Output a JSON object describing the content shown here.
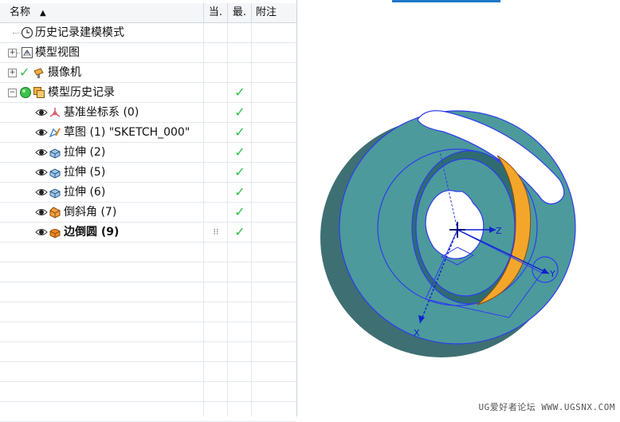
{
  "columns": {
    "name": "名称",
    "current": "当.",
    "uptodate": "最.",
    "notes": "附注"
  },
  "rows": [
    {
      "label": "历史记录建模模式",
      "icon": "clock-icon",
      "level": 0,
      "expander": "",
      "check": "",
      "current": ""
    },
    {
      "label": "模型视图",
      "icon": "model-view-icon",
      "level": 0,
      "expander": "+",
      "check": "",
      "current": ""
    },
    {
      "label": "摄像机",
      "icon": "camera-icon",
      "level": 0,
      "expander": "+",
      "check": "✓",
      "current": ""
    },
    {
      "label": "模型历史记录",
      "icon": "history-icon",
      "level": 0,
      "expander": "−",
      "check": "✓",
      "current": ""
    },
    {
      "label": "基准坐标系 (0)",
      "icon": "datum-csys-icon",
      "level": 1,
      "expander": "",
      "check": "✓",
      "current": ""
    },
    {
      "label": "草图 (1) \"SKETCH_000\"",
      "icon": "sketch-icon",
      "level": 1,
      "expander": "",
      "check": "✓",
      "current": ""
    },
    {
      "label": "拉伸 (2)",
      "icon": "extrude-icon",
      "level": 1,
      "expander": "",
      "check": "✓",
      "current": ""
    },
    {
      "label": "拉伸 (5)",
      "icon": "extrude-icon",
      "level": 1,
      "expander": "",
      "check": "✓",
      "current": ""
    },
    {
      "label": "拉伸 (6)",
      "icon": "extrude-icon",
      "level": 1,
      "expander": "",
      "check": "✓",
      "current": ""
    },
    {
      "label": "倒斜角 (7)",
      "icon": "chamfer-icon",
      "level": 1,
      "expander": "",
      "check": "✓",
      "current": ""
    },
    {
      "label": "边倒圆 (9)",
      "icon": "edge-blend-icon",
      "level": 1,
      "expander": "",
      "check": "✓",
      "current": "⁝⁝",
      "bold": true
    }
  ],
  "viewport": {
    "axis_x": "X",
    "axis_y": "Y",
    "axis_z": "Z"
  },
  "watermark": "UG爱好者论坛 WWW.UGSNX.COM",
  "colors": {
    "part": "#4c9a9c",
    "edge": "#2f3cf0",
    "fillet": "#f4a62a",
    "check": "#2fc04a"
  }
}
